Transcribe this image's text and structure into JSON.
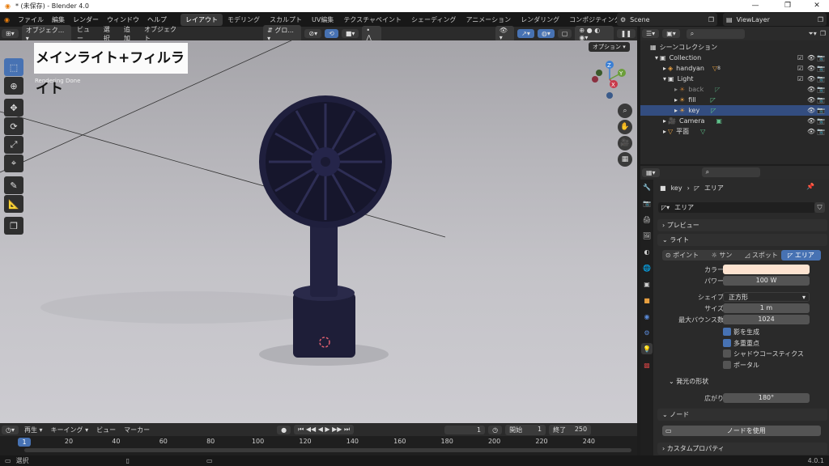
{
  "window": {
    "title": "* (未保存) - Blender 4.0",
    "minimize": "—",
    "maximize": "❐",
    "close": "✕"
  },
  "menu": {
    "items": [
      "ファイル",
      "編集",
      "レンダー",
      "ウィンドウ",
      "ヘルプ"
    ],
    "workspaces": [
      "レイアウト",
      "モデリング",
      "スカルプト",
      "UV編集",
      "テクスチャペイント",
      "シェーディング",
      "アニメーション",
      "レンダリング",
      "コンポジティング"
    ],
    "active_workspace": "レイアウト",
    "scene": "Scene",
    "view_layer": "ViewLayer"
  },
  "viewport_header": {
    "mode": "オブジェク...",
    "menus": [
      "ビュー",
      "選択",
      "追加",
      "オブジェクト"
    ],
    "transform_orientation": "グロ..."
  },
  "viewport": {
    "overlay_label": "メインライト+フィルライト",
    "render_status": "Rendering Done",
    "options_button": "オプション",
    "gizmo_axes": {
      "z": "Z",
      "y": "Y",
      "x": "X"
    }
  },
  "timeline_header": {
    "playback": "再生",
    "keying": "キーイング",
    "view": "ビュー",
    "marker": "マーカー",
    "current_frame": "1",
    "start_label": "開始",
    "start": "1",
    "end_label": "終了",
    "end": "250"
  },
  "timeline": {
    "current": "1",
    "ticks": [
      "20",
      "40",
      "60",
      "80",
      "100",
      "120",
      "140",
      "160",
      "180",
      "200",
      "220",
      "240"
    ]
  },
  "statusbar": {
    "select": "選択"
  },
  "outliner": {
    "root": "シーンコレクション",
    "collection": "Collection",
    "handyan": "handyan",
    "handyan_badge": "8",
    "light": "Light",
    "back": "back",
    "fill": "fill",
    "key": "key",
    "camera": "Camera",
    "plane": "平面"
  },
  "properties": {
    "breadcrumb_object": "key",
    "breadcrumb_data": "エリア",
    "datablock": "エリア",
    "panel_preview": "プレビュー",
    "panel_light": "ライト",
    "light_types": [
      "ポイント",
      "サン",
      "スポット",
      "エリア"
    ],
    "active_type": "エリア",
    "color_label": "カラー",
    "color_value": "#fde3d0",
    "power_label": "パワー",
    "power": "100 W",
    "shape_label": "シェイプ",
    "shape": "正方形",
    "size_label": "サイズ",
    "size": "1 m",
    "bounces_label": "最大バウンス数",
    "bounces": "1024",
    "cast_shadow": "影を生成",
    "multiple_importance": "多重重点",
    "shadow_caustics": "シャドウコースティクス",
    "portal": "ポータル",
    "emission_shape_panel": "発光の形状",
    "spread_label": "広がり",
    "spread": "180°",
    "nodes_panel": "ノード",
    "use_nodes": "ノードを使用",
    "custom_props": "カスタムプロパティ"
  }
}
